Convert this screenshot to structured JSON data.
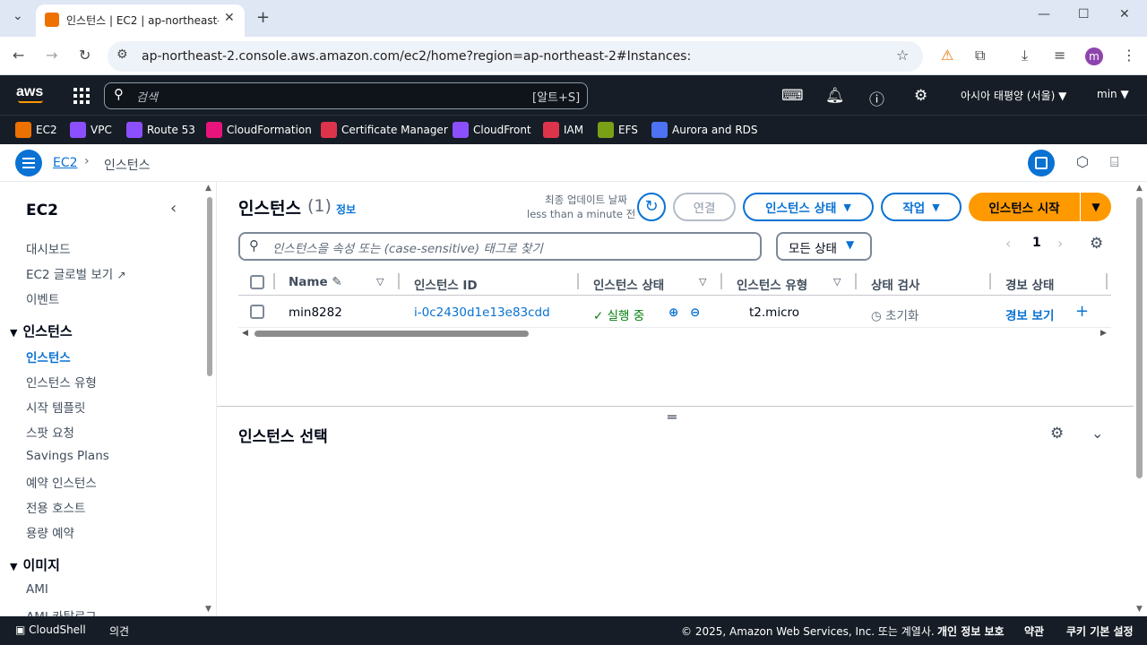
{
  "browser": {
    "tab_title": "인스턴스 | EC2 | ap-northeast-",
    "url": "ap-northeast-2.console.aws.amazon.com/ec2/home?region=ap-northeast-2#Instances:",
    "profile_initial": "m"
  },
  "aws_nav": {
    "logo": "aws",
    "search_placeholder": "검색",
    "search_shortcut": "[알트+S]",
    "region": "아시아 태평양 (서울) ▼",
    "user": "min ▼"
  },
  "favorites": [
    {
      "label": "EC2",
      "color": "#ed7100"
    },
    {
      "label": "VPC",
      "color": "#8c4fff"
    },
    {
      "label": "Route 53",
      "color": "#8c4fff"
    },
    {
      "label": "CloudFormation",
      "color": "#e7157b"
    },
    {
      "label": "Certificate Manager",
      "color": "#dd344c"
    },
    {
      "label": "CloudFront",
      "color": "#8c4fff"
    },
    {
      "label": "IAM",
      "color": "#dd344c"
    },
    {
      "label": "EFS",
      "color": "#7aa116"
    },
    {
      "label": "Aurora and RDS",
      "color": "#4d72f3"
    }
  ],
  "breadcrumb": {
    "service": "EC2",
    "separator": "›",
    "current": "인스턴스"
  },
  "sidebar": {
    "title": "EC2",
    "top_links": [
      "대시보드",
      "EC2 글로벌 보기",
      "이벤트"
    ],
    "sections": [
      {
        "title": "인스턴스",
        "items": [
          "인스턴스",
          "인스턴스 유형",
          "시작 템플릿",
          "스팟 요청",
          "Savings Plans",
          "예약 인스턴스",
          "전용 호스트",
          "용량 예약"
        ]
      },
      {
        "title": "이미지",
        "items": [
          "AMI",
          "AMI 카탈로그"
        ]
      }
    ]
  },
  "main": {
    "title": "인스턴스",
    "count": "(1)",
    "info": "정보",
    "last_updated_label": "최종 업데이트 날짜",
    "last_updated_value": "less than a minute 전",
    "connect": "연결",
    "instance_state": "인스턴스 상태",
    "actions": "작업",
    "launch": "인스턴스 시작",
    "filter_placeholder": "인스턴스을 속성 또는 (case-sensitive) 태그로 찾기",
    "state_filter": "모든 상태",
    "page": "1",
    "columns": [
      "Name",
      "인스턴스 ID",
      "인스턴스 상태",
      "인스턴스 유형",
      "상태 검사",
      "경보 상태"
    ],
    "rows": [
      {
        "name": "min8282",
        "id": "i-0c2430d1e13e83cdd",
        "state": "실행 중",
        "type": "t2.micro",
        "check": "초기화",
        "alarm": "경보 보기"
      }
    ],
    "selection_title": "인스턴스 선택"
  },
  "footer": {
    "cloudshell": "CloudShell",
    "feedback": "의견",
    "copyright": "© 2025, Amazon Web Services, Inc. 또는 계열사.",
    "privacy": "개인 정보 보호",
    "terms": "약관",
    "cookies": "쿠키 기본 설정"
  }
}
